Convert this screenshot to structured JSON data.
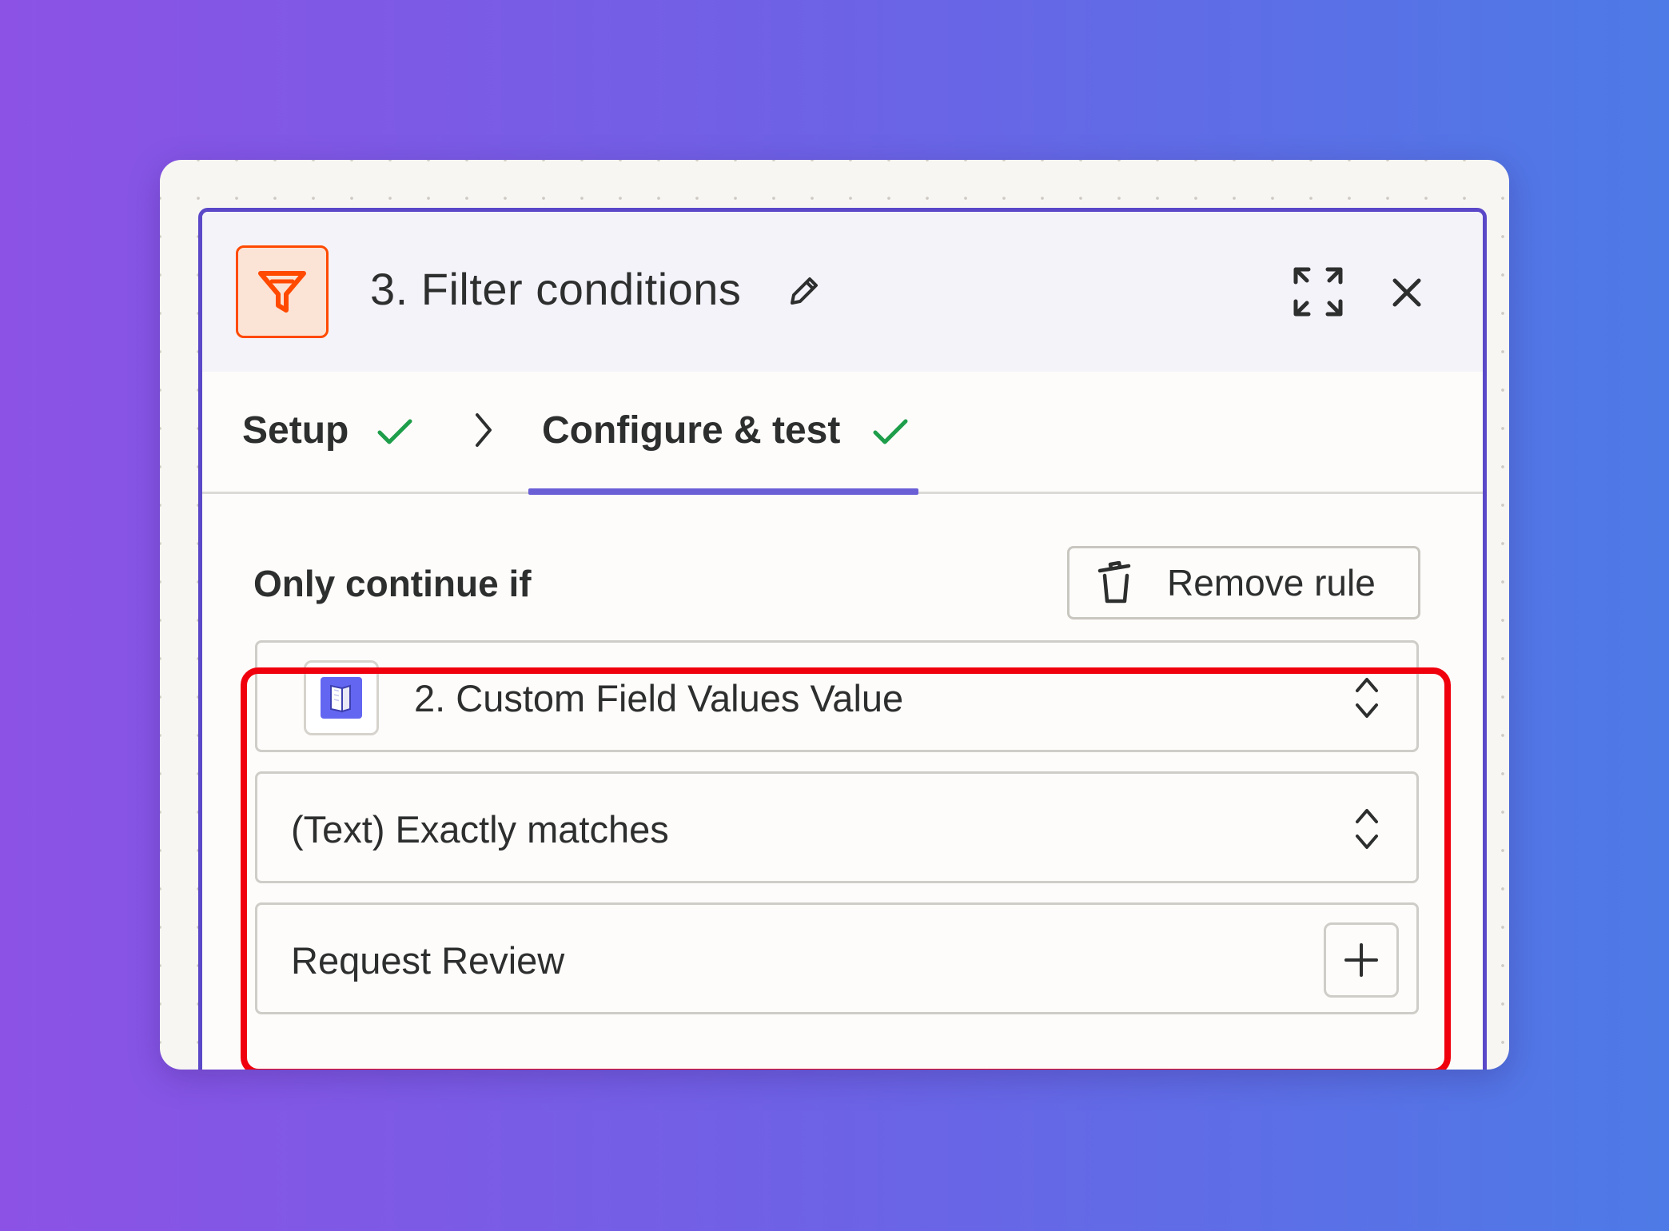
{
  "step": {
    "title": "3. Filter conditions",
    "icon": "filter-icon",
    "accent_color": "#ff4a00",
    "panel_border_color": "#5a48c8"
  },
  "header_actions": {
    "edit_icon": "pencil-icon",
    "expand_icon": "expand-icon",
    "close_icon": "close-icon"
  },
  "tabs": [
    {
      "label": "Setup",
      "complete": true,
      "active": false
    },
    {
      "label": "Configure & test",
      "complete": true,
      "active": true
    }
  ],
  "rule": {
    "section_label": "Only continue if",
    "remove_label": "Remove rule",
    "field": "2. Custom Field Values Value",
    "condition": "(Text) Exactly matches",
    "value": "Request Review"
  },
  "highlight_color": "#f0000d",
  "check_color": "#1e9e4a"
}
